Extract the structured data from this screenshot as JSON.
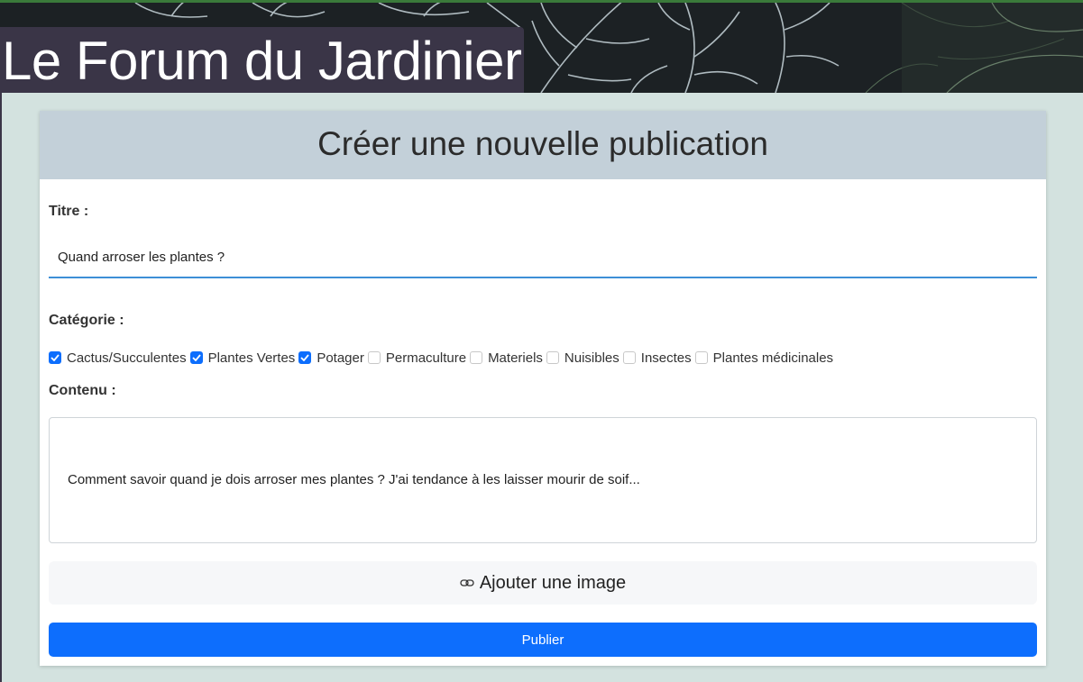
{
  "site": {
    "title": "Le Forum du Jardinier"
  },
  "form": {
    "heading": "Créer une nouvelle publication",
    "title_label": "Titre :",
    "title_value": "Quand arroser les plantes ?",
    "category_label": "Catégorie :",
    "categories": [
      {
        "label": "Cactus/Succulentes",
        "checked": true
      },
      {
        "label": "Plantes Vertes",
        "checked": true
      },
      {
        "label": "Potager",
        "checked": true
      },
      {
        "label": "Permaculture",
        "checked": false
      },
      {
        "label": "Materiels",
        "checked": false
      },
      {
        "label": "Nuisibles",
        "checked": false
      },
      {
        "label": "Insectes",
        "checked": false
      },
      {
        "label": "Plantes médicinales",
        "checked": false
      }
    ],
    "content_label": "Contenu :",
    "content_value": "Comment savoir quand je dois arroser mes plantes ? J'ai tendance à les laisser mourir de soif...",
    "add_image_label": "Ajouter une image",
    "add_image_icon": "link-icon",
    "publish_label": "Publier"
  },
  "colors": {
    "page_background": "#d3e2df",
    "title_background": "#3a3547",
    "card_header": "#c3d0d9",
    "accent_blue": "#0d6efd",
    "input_underline": "#3d8fd6"
  }
}
